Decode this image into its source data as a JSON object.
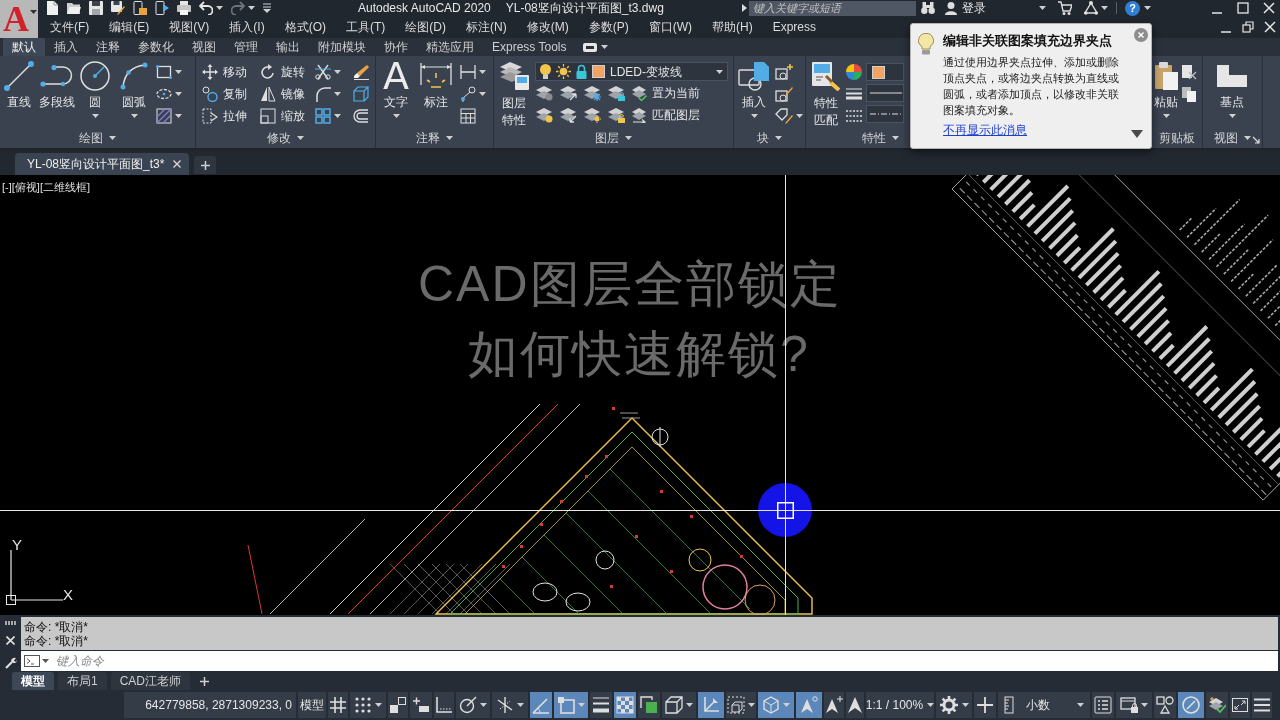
{
  "app_button": {
    "glyph": "A"
  },
  "title_bar": {
    "title": "Autodesk AutoCAD 2020",
    "document": "YL-08竖向设计平面图_t3.dwg",
    "search": {
      "placeholder": "键入关键字或短语"
    },
    "sign_in": "登录",
    "help_glyph": "?"
  },
  "menu_bar": [
    "文件(F)",
    "编辑(E)",
    "视图(V)",
    "插入(I)",
    "格式(O)",
    "工具(T)",
    "绘图(D)",
    "标注(N)",
    "修改(M)",
    "参数(P)",
    "窗口(W)",
    "帮助(H)",
    "Express"
  ],
  "ribbon": {
    "tabs": [
      {
        "label": "默认",
        "selected": true
      },
      {
        "label": "插入",
        "selected": false
      },
      {
        "label": "注释",
        "selected": false
      },
      {
        "label": "参数化",
        "selected": false
      },
      {
        "label": "视图",
        "selected": false
      },
      {
        "label": "管理",
        "selected": false
      },
      {
        "label": "输出",
        "selected": false
      },
      {
        "label": "附加模块",
        "selected": false
      },
      {
        "label": "协作",
        "selected": false
      },
      {
        "label": "精选应用",
        "selected": false
      },
      {
        "label": "Express Tools",
        "selected": false
      }
    ],
    "panels": [
      {
        "kind": "draw",
        "title": "绘图",
        "buttons": [
          "直线",
          "多段线",
          "圆",
          "圆弧"
        ]
      },
      {
        "kind": "modify",
        "title": "修改",
        "buttons": [
          "移动",
          "旋转",
          "复制",
          "镜像",
          "拉伸",
          "缩放"
        ]
      },
      {
        "kind": "annotation",
        "title": "注释",
        "glyph": "A",
        "buttons": [
          "文字",
          "标注"
        ]
      },
      {
        "kind": "layers",
        "title": "图层",
        "buttons": [
          "图层特性",
          "置为当前",
          "匹配图层"
        ],
        "layer": "LDED-变坡线"
      },
      {
        "kind": "block",
        "title": "块",
        "buttons": [
          "插入"
        ]
      },
      {
        "kind": "properties",
        "title": "特性",
        "buttons": [
          "特性匹配"
        ]
      },
      {
        "kind": "clipboard",
        "title": "剪贴板",
        "buttons": [
          "粘贴"
        ]
      },
      {
        "kind": "view",
        "title": "视图",
        "buttons": [
          "基点"
        ]
      }
    ]
  },
  "tooltip": {
    "title": "编辑非关联图案填充边界夹点",
    "body": "通过使用边界夹点拉伸、添加或删除顶点夹点，或将边夹点转换为直线或圆弧，或者添加顶点，以修改非关联图案填充对象。",
    "link": "不再显示此消息"
  },
  "document_tabs": [
    {
      "label": "YL-08竖向设计平面图_t3*",
      "selected": true
    }
  ],
  "viewport": {
    "controls": [
      "[-]",
      "[俯视]",
      "[二维线框]"
    ],
    "drawing_text": [
      "CAD图层全部锁定",
      "如何快速解锁?"
    ],
    "ucs": {
      "x_label": "X",
      "y_label": "Y"
    }
  },
  "command_line": {
    "history": [
      "命令: *取消*",
      "命令: *取消*"
    ],
    "placeholder": "键入命令"
  },
  "layout_tabs": [
    {
      "label": "模型",
      "selected": true
    },
    {
      "label": "布局1",
      "selected": false
    },
    {
      "label": "CAD江老师",
      "selected": false
    }
  ],
  "status_bar": {
    "coordinates": "642779858, 2871309233, 0",
    "space": "模型",
    "tools": [
      {
        "on": false
      },
      {
        "on": false
      },
      {
        "on": false
      },
      {
        "on": false
      },
      {
        "on": false
      },
      {
        "on": false
      },
      {
        "on": false
      },
      {
        "on": true
      },
      {
        "on": true
      },
      {
        "on": false
      },
      {
        "on": true
      },
      {
        "on": false
      },
      {
        "on": false
      },
      {
        "on": true
      },
      {
        "on": false
      },
      {
        "on": true
      },
      {
        "on": true
      },
      {
        "on": false
      },
      {
        "on": false
      }
    ],
    "annotation_scale": "1:1 / 100%",
    "units": "小数",
    "more_tools": [
      {
        "on": false
      },
      {
        "on": false
      },
      {
        "on": false
      },
      {
        "on": true
      },
      {
        "on": false
      }
    ]
  }
}
